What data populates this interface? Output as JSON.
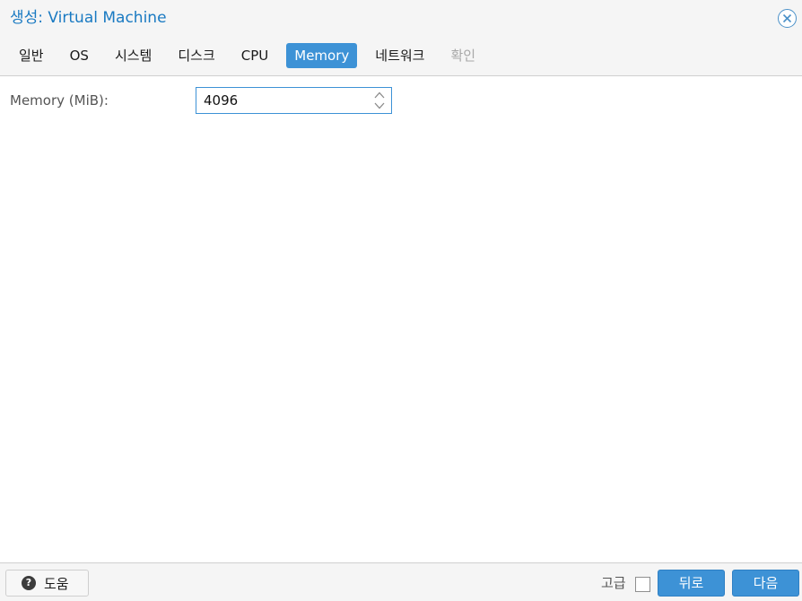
{
  "dialog": {
    "title": "생성: Virtual Machine"
  },
  "tabs": [
    {
      "label": "일반",
      "state": "normal"
    },
    {
      "label": "OS",
      "state": "normal"
    },
    {
      "label": "시스템",
      "state": "normal"
    },
    {
      "label": "디스크",
      "state": "normal"
    },
    {
      "label": "CPU",
      "state": "normal"
    },
    {
      "label": "Memory",
      "state": "active"
    },
    {
      "label": "네트워크",
      "state": "normal"
    },
    {
      "label": "확인",
      "state": "disabled"
    }
  ],
  "memory": {
    "label": "Memory (MiB):",
    "value": "4096"
  },
  "footer": {
    "help_label": "도움",
    "advanced_label": "고급",
    "advanced_checked": false,
    "back_label": "뒤로",
    "next_label": "다음"
  },
  "icons": {
    "close": "close-icon",
    "help": "question-circle-icon",
    "spin_up": "chevron-up-icon",
    "spin_down": "chevron-down-icon"
  },
  "colors": {
    "accent": "#3d92d6",
    "title": "#1a7ac2",
    "disabled_text": "#a8a8a8"
  }
}
